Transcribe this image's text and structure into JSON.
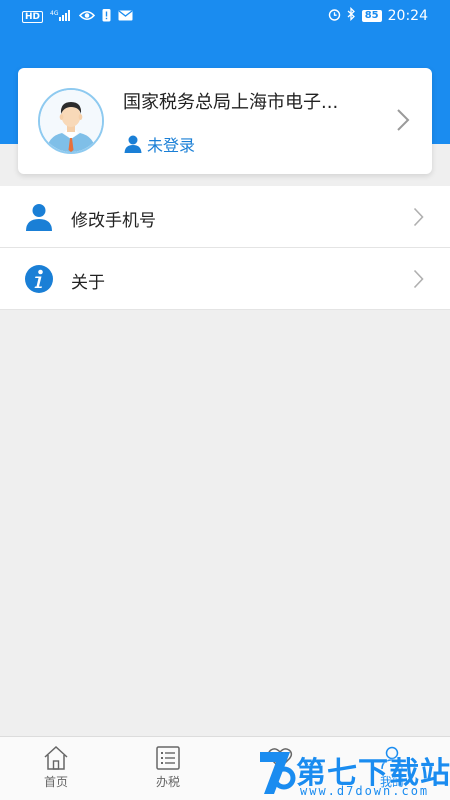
{
  "status_bar": {
    "left_badge": "HD",
    "network": "4G",
    "battery": "85",
    "time": "20:24"
  },
  "profile": {
    "org_name": "国家税务总局上海市电子...",
    "login_status": "未登录"
  },
  "menu": {
    "items": [
      {
        "label": "修改手机号",
        "icon": "user-icon"
      },
      {
        "label": "关于",
        "icon": "info-icon"
      }
    ]
  },
  "bottom_nav": {
    "items": [
      {
        "label": "首页",
        "icon": "home-icon"
      },
      {
        "label": "办税",
        "icon": "list-icon"
      },
      {
        "label": "",
        "icon": "heart-icon"
      },
      {
        "label": "我的",
        "icon": "person-icon"
      }
    ]
  },
  "watermark": {
    "title": "第七下载站",
    "url": "www.d7down.com"
  },
  "colors": {
    "brand_blue": "#1a8cf0",
    "link_blue": "#1a7fd6",
    "background": "#efefef"
  }
}
